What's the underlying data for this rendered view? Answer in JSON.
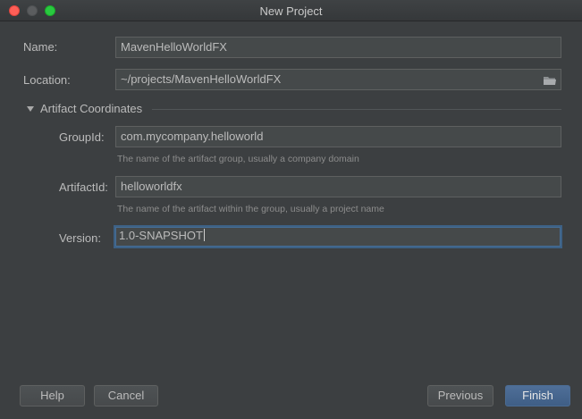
{
  "window": {
    "title": "New Project"
  },
  "form": {
    "name_label": "Name:",
    "name_value": "MavenHelloWorldFX",
    "location_label": "Location:",
    "location_value": "~/projects/MavenHelloWorldFX",
    "section_title": "Artifact Coordinates",
    "groupid_label": "GroupId:",
    "groupid_value": "com.mycompany.helloworld",
    "groupid_hint": "The name of the artifact group, usually a company domain",
    "artifactid_label": "ArtifactId:",
    "artifactid_value": "helloworldfx",
    "artifactid_hint": "The name of the artifact within the group, usually a project name",
    "version_label": "Version:",
    "version_value": "1.0-SNAPSHOT"
  },
  "buttons": {
    "help": "Help",
    "cancel": "Cancel",
    "previous": "Previous",
    "finish": "Finish"
  },
  "icons": {
    "close": "close-icon",
    "minimize": "minimize-icon",
    "maximize": "maximize-icon",
    "folder": "folder-icon",
    "expand": "triangle-down-icon"
  },
  "colors": {
    "background": "#3c3f41",
    "field": "#45494a",
    "focus_border": "#3d6185",
    "default_button": "#4a6d96",
    "close": "#fe5f57",
    "maximize": "#29c940"
  }
}
